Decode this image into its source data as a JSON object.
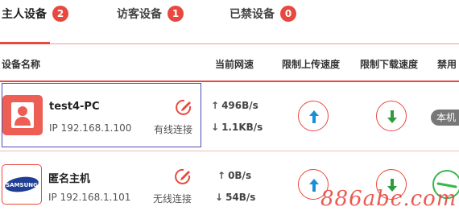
{
  "tabs": [
    {
      "label": "主人设备",
      "count": "2"
    },
    {
      "label": "访客设备",
      "count": "1"
    },
    {
      "label": "已禁设备",
      "count": "0"
    }
  ],
  "table": {
    "headers": [
      "设备名称",
      "当前网速",
      "限制上传速度",
      "限制下载速度",
      "禁用"
    ]
  },
  "devices": [
    {
      "name": "test4-PC",
      "ip": "IP 192.168.1.100",
      "connection": "有线连接",
      "upload_speed": "496B/s",
      "download_speed": "1.1KB/s",
      "disable_status": "本机",
      "avatar": "user-icon"
    },
    {
      "name": "匿名主机",
      "ip": "IP 192.168.1.101",
      "connection": "无线连接",
      "upload_speed": "0B/s",
      "download_speed": "54B/s",
      "avatar": "samsung-logo",
      "avatar_text": "SAMSUNG"
    }
  ],
  "colors": {
    "accent": "#e8493f",
    "upload_arrow": "#1a8fd8",
    "download_arrow": "#2f9a3e",
    "selection_border": "#4a4fb3",
    "toggle_green": "#35b84b"
  },
  "icons": {
    "up_arrow": "↑",
    "down_arrow": "↓"
  },
  "watermark": "886abc.com"
}
